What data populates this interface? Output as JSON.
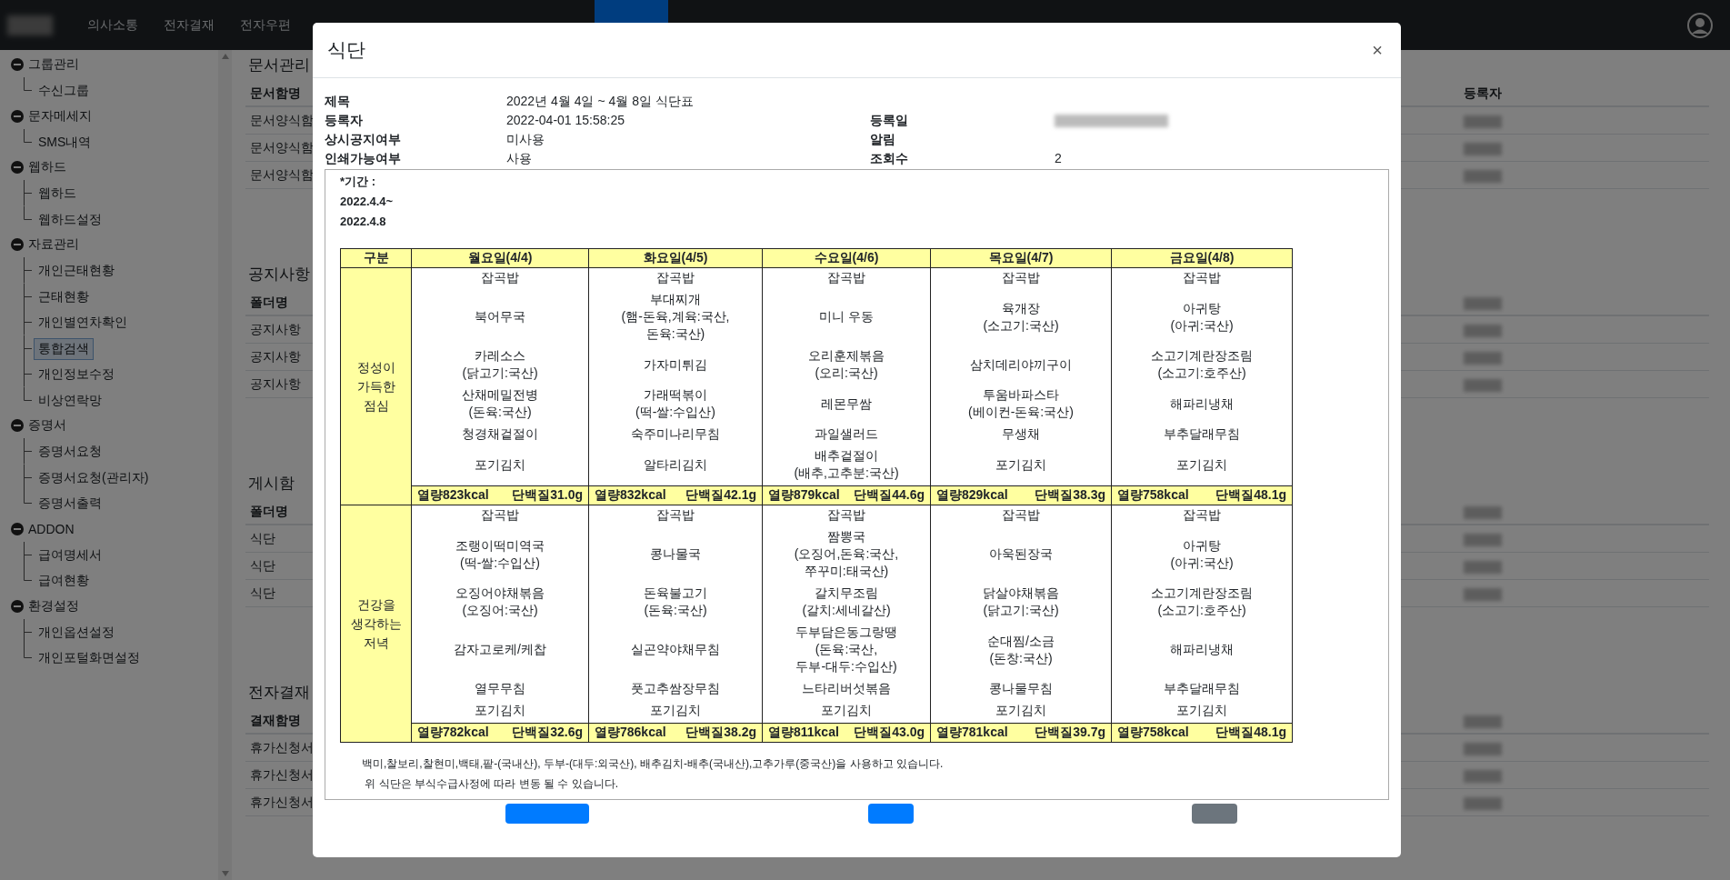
{
  "nav": {
    "logo_redacted": true,
    "items": [
      {
        "label": "의사소통"
      },
      {
        "label": "전자결재"
      },
      {
        "label": "전자우편"
      }
    ]
  },
  "sidebar": {
    "groups": [
      {
        "label": "그룹관리",
        "expanded": true,
        "children": [
          {
            "label": "수신그룹",
            "selected": false
          }
        ]
      },
      {
        "label": "문자메세지",
        "expanded": true,
        "children": [
          {
            "label": "SMS내역",
            "selected": false
          }
        ]
      },
      {
        "label": "웹하드",
        "expanded": true,
        "children": [
          {
            "label": "웹하드",
            "selected": false
          },
          {
            "label": "웹하드설정",
            "selected": false
          }
        ]
      },
      {
        "label": "자료관리",
        "expanded": true,
        "children": [
          {
            "label": "개인근태현황",
            "selected": false
          },
          {
            "label": "근태현황",
            "selected": false
          },
          {
            "label": "개인별연차확인",
            "selected": false
          },
          {
            "label": "통합검색",
            "selected": true
          },
          {
            "label": "개인정보수정",
            "selected": false
          },
          {
            "label": "비상연락망",
            "selected": false
          }
        ]
      },
      {
        "label": "증명서",
        "expanded": true,
        "children": [
          {
            "label": "증명서요청",
            "selected": false
          },
          {
            "label": "증명서요청(관리자)",
            "selected": false
          },
          {
            "label": "증명서출력",
            "selected": false
          }
        ]
      },
      {
        "label": "ADDON",
        "expanded": true,
        "children": [
          {
            "label": "급여명세서",
            "selected": false
          },
          {
            "label": "급여현황",
            "selected": false
          }
        ]
      },
      {
        "label": "환경설정",
        "expanded": true,
        "children": [
          {
            "label": "개인옵션설정",
            "selected": false
          },
          {
            "label": "개인포털화면설정",
            "selected": false
          }
        ]
      }
    ]
  },
  "sections": [
    {
      "title": "문서관리",
      "column_1": "문서함명",
      "column_2": "등록자",
      "rows": [
        {
          "cell": "문서양식함",
          "redacted": true
        },
        {
          "cell": "문서양식함",
          "redacted": true
        },
        {
          "cell": "문서양식함",
          "redacted": true
        }
      ]
    },
    {
      "title": "공지사항",
      "column_1": "폴더명",
      "rows": [
        {
          "cell": "공지사항",
          "redacted": true
        },
        {
          "cell": "공지사항",
          "redacted": true
        },
        {
          "cell": "공지사항",
          "redacted": true
        }
      ]
    },
    {
      "title": "게시함",
      "column_1": "폴더명",
      "rows": [
        {
          "cell": "식단",
          "redacted": true
        },
        {
          "cell": "식단",
          "redacted": true
        },
        {
          "cell": "식단",
          "redacted": true
        }
      ]
    },
    {
      "title": "전자결재",
      "column_1": "결재함명",
      "rows": [
        {
          "cell": "휴가신청서",
          "redacted": true
        },
        {
          "cell": "휴가신청서",
          "redacted": true
        },
        {
          "cell": "휴가신청서",
          "redacted": true
        }
      ]
    }
  ],
  "modal": {
    "title": "식단",
    "close": "×",
    "meta": [
      {
        "label": "제목",
        "value": "2022년 4월 4일 ~ 4월 8일 식단표"
      },
      {
        "label": "등록자",
        "value": "2022-04-01 15:58:25",
        "label_2": "등록일",
        "value_2_redacted": true
      },
      {
        "label": "상시공지여부",
        "value": "미사용",
        "label_2": "알림"
      },
      {
        "label": "인쇄가능여부",
        "value": "사용",
        "label_2": "조회수",
        "value_2": "2"
      }
    ],
    "period": [
      "*기간 :",
      "2022.4.4~",
      "2022.4.8"
    ],
    "table": {
      "columns": [
        "구분",
        "월요일(4/4)",
        "화요일(4/5)",
        "수요일(4/6)",
        "목요일(4/7)",
        "금요일(4/8)"
      ],
      "meals": [
        {
          "label": "정성이\n가득한\n점심",
          "rows": [
            [
              "잡곡밥",
              "잡곡밥",
              "잡곡밥",
              "잡곡밥",
              "잡곡밥"
            ],
            [
              "북어무국",
              "부대찌개\n(햄-돈육,계육:국산,\n돈육:국산)",
              "미니 우동",
              "육개장\n(소고기:국산)",
              "아귀탕\n(아귀:국산)"
            ],
            [
              "카레소스\n(닭고기:국산)",
              "가자미튀김",
              "오리훈제볶음\n(오리:국산)",
              "삼치데리야끼구이",
              "소고기계란장조림\n(소고기:호주산)"
            ],
            [
              "산채메밀전병\n(돈육:국산)",
              "가래떡볶이\n(떡-쌀:수입산)",
              "레몬무쌈",
              "투움바파스타\n(베이컨-돈육:국산)",
              "해파리냉채"
            ],
            [
              "청경채겉절이",
              "숙주미나리무침",
              "과일샐러드",
              "무생채",
              "부추달래무침"
            ],
            [
              "포기김치",
              "알타리김치",
              "배추겉절이\n(배추,고추분:국산)",
              "포기김치",
              "포기김치"
            ]
          ],
          "totals": [
            {
              "kcal": "열량823kcal",
              "protein": "단백질31.0g"
            },
            {
              "kcal": "열량832kcal",
              "protein": "단백질42.1g"
            },
            {
              "kcal": "열량879kcal",
              "protein": "단백질44.6g"
            },
            {
              "kcal": "열량829kcal",
              "protein": "단백질38.3g"
            },
            {
              "kcal": "열량758kcal",
              "protein": "단백질48.1g"
            }
          ]
        },
        {
          "label": "건강을\n생각하는\n저녁",
          "rows": [
            [
              "잡곡밥",
              "잡곡밥",
              "잡곡밥",
              "잡곡밥",
              "잡곡밥"
            ],
            [
              "조랭이떡미역국\n(떡-쌀:수입산)",
              "콩나물국",
              "짬뽕국\n(오징어,돈육:국산,\n쭈꾸미:태국산)",
              "아욱된장국",
              "아귀탕\n(아귀:국산)"
            ],
            [
              "오징어야채볶음\n(오징어:국산)",
              "돈육불고기\n(돈육:국산)",
              "갈치무조림\n(갈치:세네갈산)",
              "닭살야채볶음\n(닭고기:국산)",
              "소고기계란장조림\n(소고기:호주산)"
            ],
            [
              "감자고로케/케찹",
              "실곤약야채무침",
              "두부담은동그랑땡\n(돈육:국산,\n두부-대두:수입산)",
              "순대찜/소금\n(돈창:국산)",
              "해파리냉채"
            ],
            [
              "열무무침",
              "풋고추쌈장무침",
              "느타리버섯볶음",
              "콩나물무침",
              "부추달래무침"
            ],
            [
              "포기김치",
              "포기김치",
              "포기김치",
              "포기김치",
              "포기김치"
            ]
          ],
          "totals": [
            {
              "kcal": "열량782kcal",
              "protein": "단백질32.6g"
            },
            {
              "kcal": "열량786kcal",
              "protein": "단백질38.2g"
            },
            {
              "kcal": "열량811kcal",
              "protein": "단백질43.0g"
            },
            {
              "kcal": "열량781kcal",
              "protein": "단백질39.7g"
            },
            {
              "kcal": "열량758kcal",
              "protein": "단백질48.1g"
            }
          ]
        }
      ]
    },
    "notes": [
      "백미,찰보리,찰현미,백태,팥-(국내산), 두부-(대두:외국산), 배추김치-배추(국내산),고추가루(중국산)을 사용하고 있습니다.",
      " 위 식단은 부식수급사정에 따라 변동 될 수 있습니다."
    ],
    "footer_buttons": [
      {
        "kind": "primary"
      },
      {
        "kind": "primary"
      },
      {
        "kind": "secondary"
      }
    ]
  }
}
